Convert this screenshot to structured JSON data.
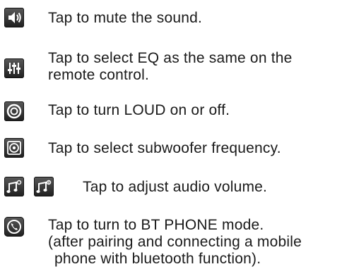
{
  "items": [
    {
      "icon": "speaker-mute-icon",
      "text": "Tap to mute the sound."
    },
    {
      "icon": "eq-sliders-icon",
      "line1": "Tap to select EQ as the same on the",
      "line2": "remote control."
    },
    {
      "icon": "loud-circle-icon",
      "text": "Tap to turn LOUD on or off."
    },
    {
      "icon": "subwoofer-icon",
      "text": "Tap to select subwoofer frequency."
    },
    {
      "icons": [
        "volume-down-icon",
        "volume-up-icon"
      ],
      "text": "Tap to adjust audio volume."
    },
    {
      "icon": "bt-phone-icon",
      "line1": "Tap to turn to BT PHONE mode.",
      "line2": "(after pairing and connecting a mobile",
      "line3": "phone with bluetooth function)."
    }
  ]
}
